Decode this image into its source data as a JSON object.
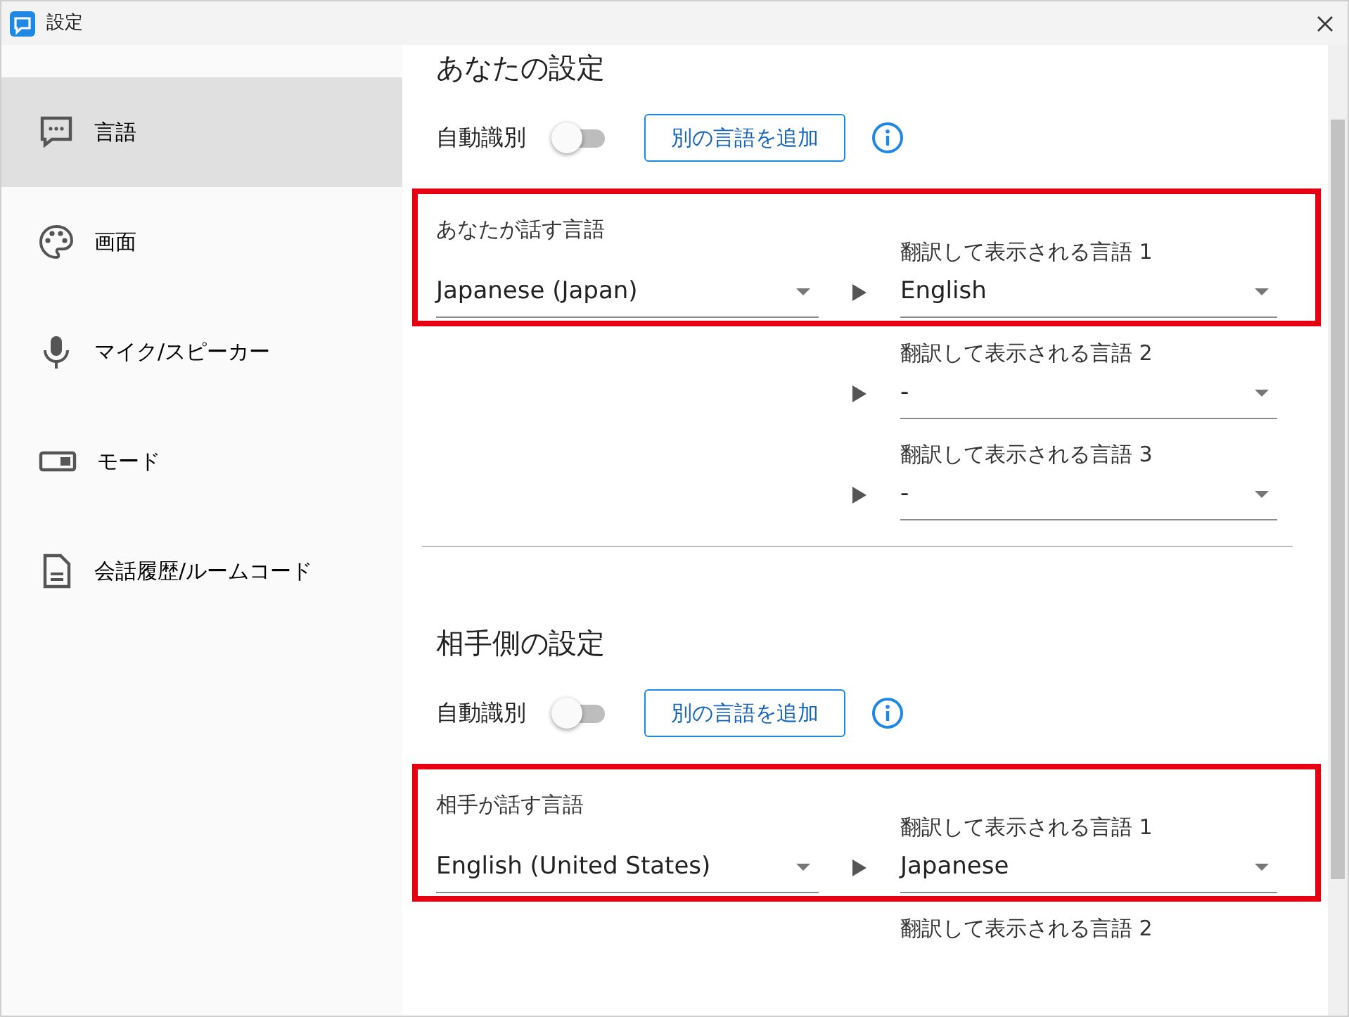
{
  "window": {
    "title": "設定"
  },
  "sidebar": {
    "items": [
      {
        "kind": "chat",
        "label": "言語",
        "selected": true
      },
      {
        "kind": "palette",
        "label": "画面",
        "selected": false
      },
      {
        "kind": "mic",
        "label": "マイク/スピーカー",
        "selected": false
      },
      {
        "kind": "mode",
        "label": "モード",
        "selected": false
      },
      {
        "kind": "document",
        "label": "会話履歴/ルームコード",
        "selected": false
      }
    ]
  },
  "sections": [
    {
      "title": "あなたの設定",
      "auto_detect": {
        "label": "自動識別",
        "on": false
      },
      "add_button": "別の言語を追加",
      "highlighted": true,
      "speaker": {
        "label": "あなたが話す言語",
        "value": "Japanese (Japan)"
      },
      "targets": [
        {
          "label": "翻訳して表示される言語 1",
          "value": "English"
        },
        {
          "label": "翻訳して表示される言語 2",
          "value": "-"
        },
        {
          "label": "翻訳して表示される言語 3",
          "value": "-"
        }
      ]
    },
    {
      "title": "相手側の設定",
      "auto_detect": {
        "label": "自動識別",
        "on": false
      },
      "add_button": "別の言語を追加",
      "highlighted": true,
      "speaker": {
        "label": "相手が話す言語",
        "value": "English (United States)"
      },
      "targets": [
        {
          "label": "翻訳して表示される言語 1",
          "value": "Japanese"
        },
        {
          "label": "翻訳して表示される言語 2"
        }
      ]
    }
  ]
}
